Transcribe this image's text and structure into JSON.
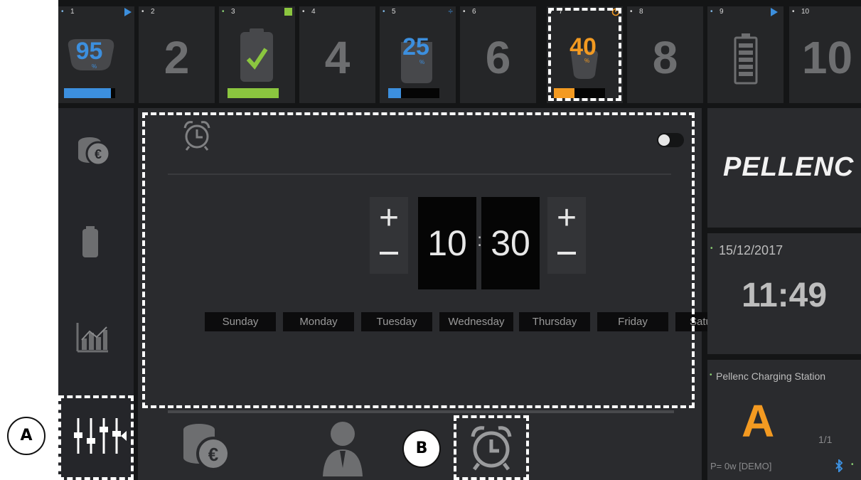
{
  "slots": [
    {
      "index": "1",
      "indicator": "play",
      "status_color": "#3c8fde",
      "value": "95",
      "unit": "%",
      "charge_fraction": 0.95
    },
    {
      "index": "2",
      "label": "2"
    },
    {
      "index": "3",
      "indicator": "full-square",
      "status_color": "#8bc63f",
      "charge_fraction": 1.0
    },
    {
      "index": "4",
      "label": "4"
    },
    {
      "index": "5",
      "indicator": "divide-sign",
      "status_color": "#3c8fde",
      "value": "25",
      "unit": "%",
      "charge_fraction": 0.25
    },
    {
      "index": "6",
      "label": "6"
    },
    {
      "index": "7",
      "indicator": "alarm-clock",
      "status_color": "#f39a21",
      "value": "40",
      "unit": "%",
      "charge_fraction": 0.4
    },
    {
      "index": "8",
      "label": "8"
    },
    {
      "index": "9",
      "indicator": "play",
      "icon": "battery-icon"
    },
    {
      "index": "10",
      "label": "10"
    }
  ],
  "sidebar": {
    "icons": [
      "coins-euro-icon",
      "battery-pellenc-icon",
      "chart-icon",
      "sliders-icon"
    ]
  },
  "alarm": {
    "enabled": false,
    "hour": "10",
    "separator": ":",
    "minute": "30",
    "plus": "+",
    "days": [
      "Sunday",
      "Monday",
      "Tuesday",
      "Wednesday",
      "Thursday",
      "Friday",
      "Saturday"
    ]
  },
  "bottom_tabs": [
    "coins-euro-icon",
    "user-icon",
    "alarm-clock-icon"
  ],
  "brand": {
    "logo_text": "PELLENC"
  },
  "datetime": {
    "date": "15/12/2017",
    "time": "11:49"
  },
  "station": {
    "name": "Pellenc Charging Station",
    "letter": "A",
    "page": "1/1",
    "power": "P= 0w [DEMO]",
    "icons": [
      "bluetooth-icon"
    ]
  },
  "colors": {
    "blue": "#3c8fde",
    "green": "#8bc63f",
    "orange": "#f39a21",
    "background": "#141516",
    "panel": "#2a2b2e"
  },
  "annotations": {
    "a": "A",
    "b": "B"
  }
}
